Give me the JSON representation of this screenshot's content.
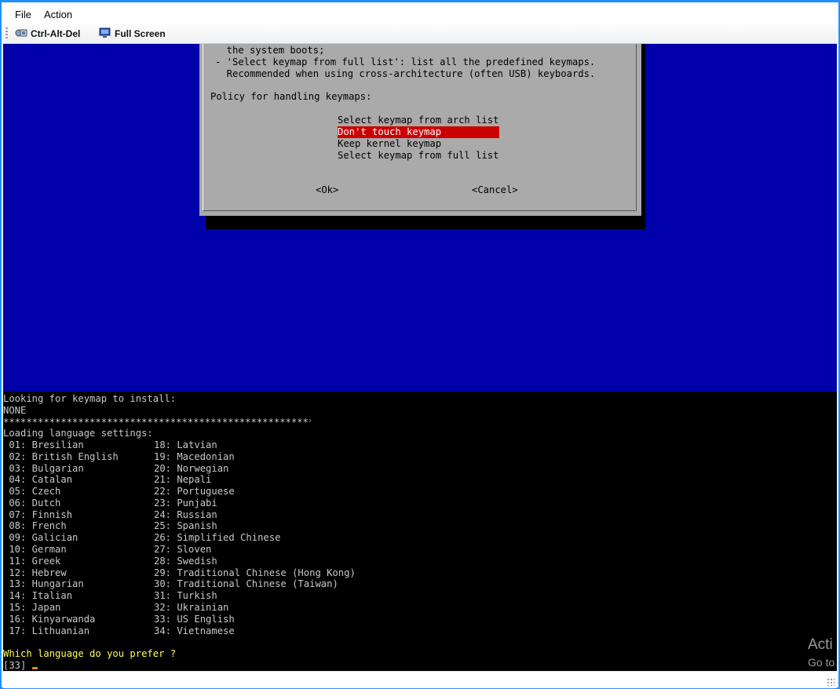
{
  "menu": {
    "file": "File",
    "action": "Action"
  },
  "toolbar": {
    "ctrl_alt_del": "Ctrl-Alt-Del",
    "full_screen": "Full Screen",
    "icons": [
      "keyboard-icon",
      "monitor-icon"
    ]
  },
  "dialog": {
    "lines": [
      "  the system boots;",
      "- 'Select keymap from full list': list all the predefined keymaps.",
      "  Recommended when using cross-architecture (often USB) keyboards."
    ],
    "prompt": "Policy for handling keymaps:",
    "options": [
      "Select keymap from arch list",
      "Don't touch keymap",
      "Keep kernel keymap",
      "Select keymap from full list"
    ],
    "selected_index": 1,
    "ok": "<Ok>",
    "cancel": "<Cancel>"
  },
  "console": {
    "header1": "Looking for keymap to install:",
    "header2": "NONE",
    "separator": "**********************************************************",
    "loading": "Loading language settings:",
    "languages_left": [
      " 01: Bresilian",
      " 02: British English",
      " 03: Bulgarian",
      " 04: Catalan",
      " 05: Czech",
      " 06: Dutch",
      " 07: Finnish",
      " 08: French",
      " 09: Galician",
      " 10: German",
      " 11: Greek",
      " 12: Hebrew",
      " 13: Hungarian",
      " 14: Italian",
      " 15: Japan",
      " 16: Kinyarwanda",
      " 17: Lithuanian"
    ],
    "languages_right": [
      "18: Latvian",
      "19: Macedonian",
      "20: Norwegian",
      "21: Nepali",
      "22: Portuguese",
      "23: Punjabi",
      "24: Russian",
      "25: Spanish",
      "26: Simplified Chinese",
      "27: Sloven",
      "28: Swedish",
      "29: Traditional Chinese (Hong Kong)",
      "30: Traditional Chinese (Taiwan)",
      "31: Turkish",
      "32: Ukrainian",
      "33: US English",
      "34: Vietnamese"
    ],
    "question": "Which language do you prefer ?",
    "input_prefix": "[33]"
  },
  "watermark": {
    "line1": "Acti",
    "line2": "Go to"
  },
  "colors": {
    "screen_bg": "#0000aa",
    "dialog_bg": "#aaaaaa",
    "selection": "#cc0000",
    "console_bg": "#000000",
    "prompt_yellow": "#ffff55"
  }
}
